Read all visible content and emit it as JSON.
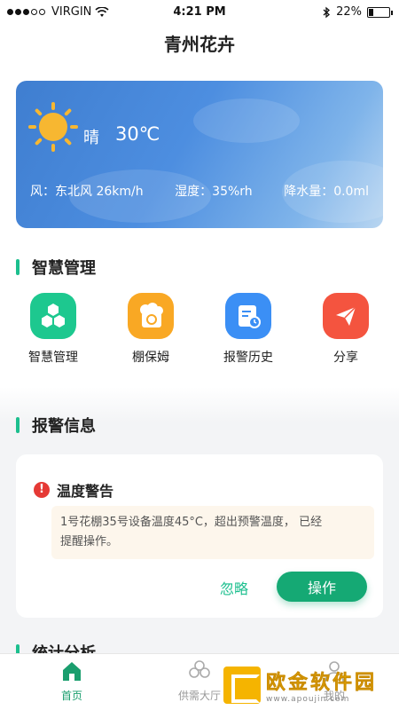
{
  "status": {
    "carrier": "VIRGIN",
    "time": "4:21 PM",
    "battery": "22%",
    "battery_level": 0.22
  },
  "header": {
    "title": "青州花卉"
  },
  "weather": {
    "icon": "sun-icon",
    "condition": "晴",
    "temperature": "30℃",
    "wind": "风：东北风 26km/h",
    "humidity": "湿度：35%rh",
    "rain": "降水量：0.0ml"
  },
  "smart": {
    "title": "智慧管理",
    "items": [
      {
        "label": "智慧管理",
        "icon": "hexagons-icon",
        "color": "#1dc88f"
      },
      {
        "label": "棚保姆",
        "icon": "greenhouse-icon",
        "color": "#f9a824"
      },
      {
        "label": "报警历史",
        "icon": "history-icon",
        "color": "#3b8ff5"
      },
      {
        "label": "分享",
        "icon": "share-icon",
        "color": "#f4543f"
      }
    ]
  },
  "alerts": {
    "title": "报警信息",
    "card": {
      "title": "温度警告",
      "message_line1": "1号花棚35号设备温度45°C，超出预警温度， 已经",
      "message_line2": "提醒操作。",
      "ignore": "忽略",
      "action": "操作"
    }
  },
  "stats": {
    "title": "统计分析"
  },
  "tabbar": {
    "tabs": [
      {
        "label": "首页"
      },
      {
        "label": "供需大厅"
      },
      {
        "label": "我的"
      }
    ]
  },
  "watermark": {
    "title": "欧金软件园",
    "url": "www.apoujin.com"
  },
  "colors": {
    "accent": "#1cbf8e",
    "primary_button": "#15a974",
    "weather_blue": "#4d8ee0"
  }
}
